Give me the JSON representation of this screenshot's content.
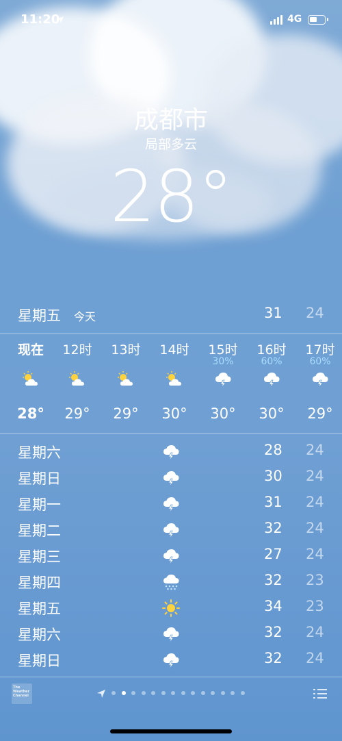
{
  "status_bar": {
    "time": "11:20",
    "network": "4G"
  },
  "location": {
    "city": "成都市",
    "condition": "局部多云",
    "temperature": "28°"
  },
  "today": {
    "day": "星期五",
    "tag": "今天",
    "high": "31",
    "low": "24"
  },
  "hourly": [
    {
      "label": "现在",
      "prob": "",
      "icon": "partly-cloudy-sun-icon",
      "temp": "28°",
      "bold": true
    },
    {
      "label": "12时",
      "prob": "",
      "icon": "partly-cloudy-sun-icon",
      "temp": "29°"
    },
    {
      "label": "13时",
      "prob": "",
      "icon": "partly-cloudy-sun-icon",
      "temp": "29°"
    },
    {
      "label": "14时",
      "prob": "",
      "icon": "partly-cloudy-sun-icon",
      "temp": "30°"
    },
    {
      "label": "15时",
      "prob": "30%",
      "icon": "thunderstorm-icon",
      "temp": "30°"
    },
    {
      "label": "16时",
      "prob": "60%",
      "icon": "thunderstorm-icon",
      "temp": "30°"
    },
    {
      "label": "17时",
      "prob": "60%",
      "icon": "thunderstorm-icon",
      "temp": "29°"
    }
  ],
  "daily": [
    {
      "day": "星期六",
      "icon": "thunderstorm-icon",
      "high": "28",
      "low": "24"
    },
    {
      "day": "星期日",
      "icon": "thunderstorm-icon",
      "high": "30",
      "low": "24"
    },
    {
      "day": "星期一",
      "icon": "thunderstorm-icon",
      "high": "31",
      "low": "24"
    },
    {
      "day": "星期二",
      "icon": "thunderstorm-icon",
      "high": "32",
      "low": "24"
    },
    {
      "day": "星期三",
      "icon": "thunderstorm-icon",
      "high": "27",
      "low": "24"
    },
    {
      "day": "星期四",
      "icon": "rain-icon",
      "high": "32",
      "low": "23"
    },
    {
      "day": "星期五",
      "icon": "sun-icon",
      "high": "34",
      "low": "23"
    },
    {
      "day": "星期六",
      "icon": "thunderstorm-icon",
      "high": "32",
      "low": "24"
    },
    {
      "day": "星期日",
      "icon": "thunderstorm-icon",
      "high": "32",
      "low": "24"
    }
  ],
  "footer": {
    "logo_text": "The Weather Channel",
    "page_count": 14,
    "active_page": 1
  },
  "colors": {
    "precip_prob": "#a9dcff",
    "low_temp": "rgba(255,255,255,0.6)"
  }
}
